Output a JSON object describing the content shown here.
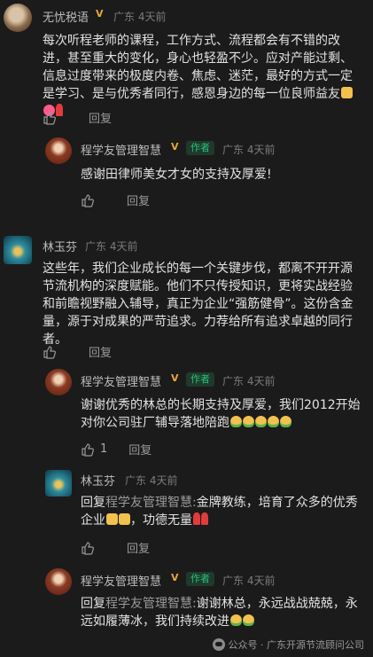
{
  "comments": [
    {
      "user": "无忧税语",
      "region": "广东",
      "time": "4天前",
      "text": "每次听程老师的课程，工作方式、流程都会有不错的改进，甚至重大的变化，身心也轻盈不少。应对产能过剩、信息过度带来的极度内卷、焦虑、迷茫，最好的方式一定是学习、是与优秀者同行，感恩身边的每一位良师益友",
      "reply_label": "回复",
      "reply": {
        "user": "程学友管理智慧",
        "author_tag": "作者",
        "region": "广东",
        "time": "4天前",
        "text": "感谢田律师美女才女的支持及厚爱!",
        "reply_label": "回复"
      }
    },
    {
      "user": "林玉芬",
      "region": "广东",
      "time": "4天前",
      "text": "这些年，我们企业成长的每一个关键步伐，都离不开开源节流机构的深度赋能。他们不只传授知识，更将实战经验和前瞻视野融入辅导，真正为企业“强筋健骨”。这份含金量，源于对成果的严苛追求。力荐给所有追求卓越的同行者。",
      "reply_label": "回复",
      "replies": [
        {
          "user": "程学友管理智慧",
          "author_tag": "作者",
          "region": "广东",
          "time": "4天前",
          "text": "谢谢优秀的林总的长期支持及厚爱，我们2012开始对你公司驻厂辅导落地陪跑",
          "like_count": "1",
          "reply_label": "回复"
        },
        {
          "user": "林玉芬",
          "region": "广东",
          "time": "4天前",
          "reply_prefix": "回复",
          "reply_to": "程学友管理智慧:",
          "text": "金牌教练，培育了众多的优秀企业",
          "text_tail": "，功德无量",
          "reply_label": "回复"
        },
        {
          "user": "程学友管理智慧",
          "author_tag": "作者",
          "region": "广东",
          "time": "4天前",
          "reply_prefix": "回复",
          "reply_to": "程学友管理智慧:",
          "text": "谢谢林总，永远战战兢兢，永远如履薄冰，我们持续改进"
        }
      ]
    }
  ],
  "watermark": "公众号 · 广东开源节流顾问公司",
  "colors": {
    "background": "#1b1b1b",
    "author_tag": "#27c07a",
    "vip_badge": "#e8a53a"
  }
}
